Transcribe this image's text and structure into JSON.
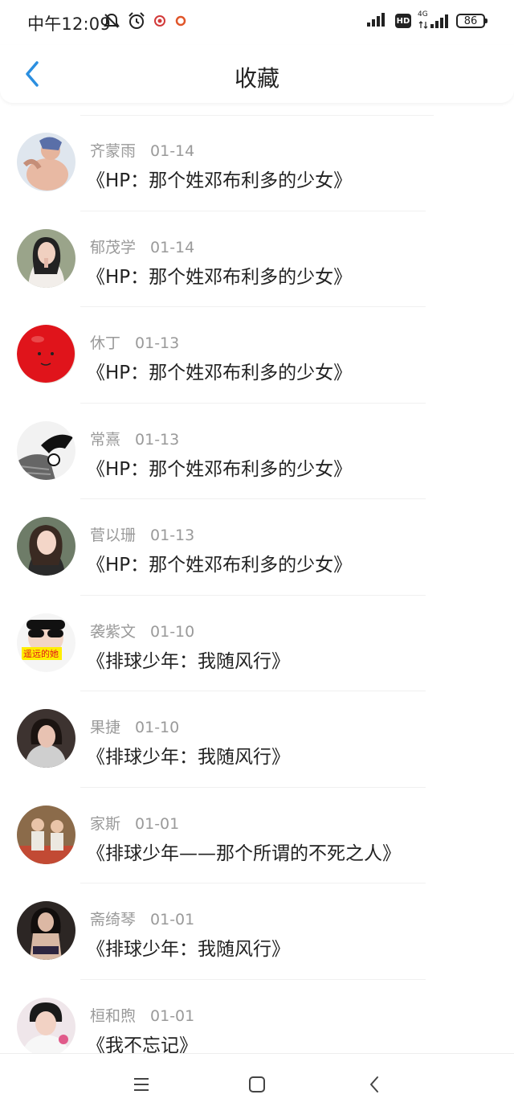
{
  "status_bar": {
    "time": "中午12:09",
    "network": "4G",
    "hd": "HD",
    "battery": "86"
  },
  "header": {
    "title": "收藏",
    "back_icon": "chevron-left-icon",
    "accent_color": "#2b8fe0"
  },
  "items": [
    {
      "name": "齐蒙雨",
      "date": "01-14",
      "title": "《HP：那个姓邓布利多的少女》",
      "avatar": "photo"
    },
    {
      "name": "郁茂学",
      "date": "01-14",
      "title": "《HP：那个姓邓布利多的少女》",
      "avatar": "photo"
    },
    {
      "name": "休丁",
      "date": "01-13",
      "title": "《HP：那个姓邓布利多的少女》",
      "avatar": "red-balloon"
    },
    {
      "name": "常熹",
      "date": "01-13",
      "title": "《HP：那个姓邓布利多的少女》",
      "avatar": "sketch"
    },
    {
      "name": "菅以珊",
      "date": "01-13",
      "title": "《HP：那个姓邓布利多的少女》",
      "avatar": "photo"
    },
    {
      "name": "袭紫文",
      "date": "01-10",
      "title": "《排球少年：我随风行》",
      "avatar": "photo",
      "avatar_caption": "遥远的她"
    },
    {
      "name": "果捷",
      "date": "01-10",
      "title": "《排球少年：我随风行》",
      "avatar": "photo"
    },
    {
      "name": "家斯",
      "date": "01-01",
      "title": "《排球少年——那个所谓的不死之人》",
      "avatar": "photo"
    },
    {
      "name": "斋绮琴",
      "date": "01-01",
      "title": "《排球少年：我随风行》",
      "avatar": "photo"
    },
    {
      "name": "桓和煦",
      "date": "01-01",
      "title": "《我不忘记》",
      "avatar": "photo"
    }
  ],
  "nav_bar": {
    "menu_icon": "menu-icon",
    "home_icon": "home-square-icon",
    "back_icon": "back-chevron-icon"
  }
}
